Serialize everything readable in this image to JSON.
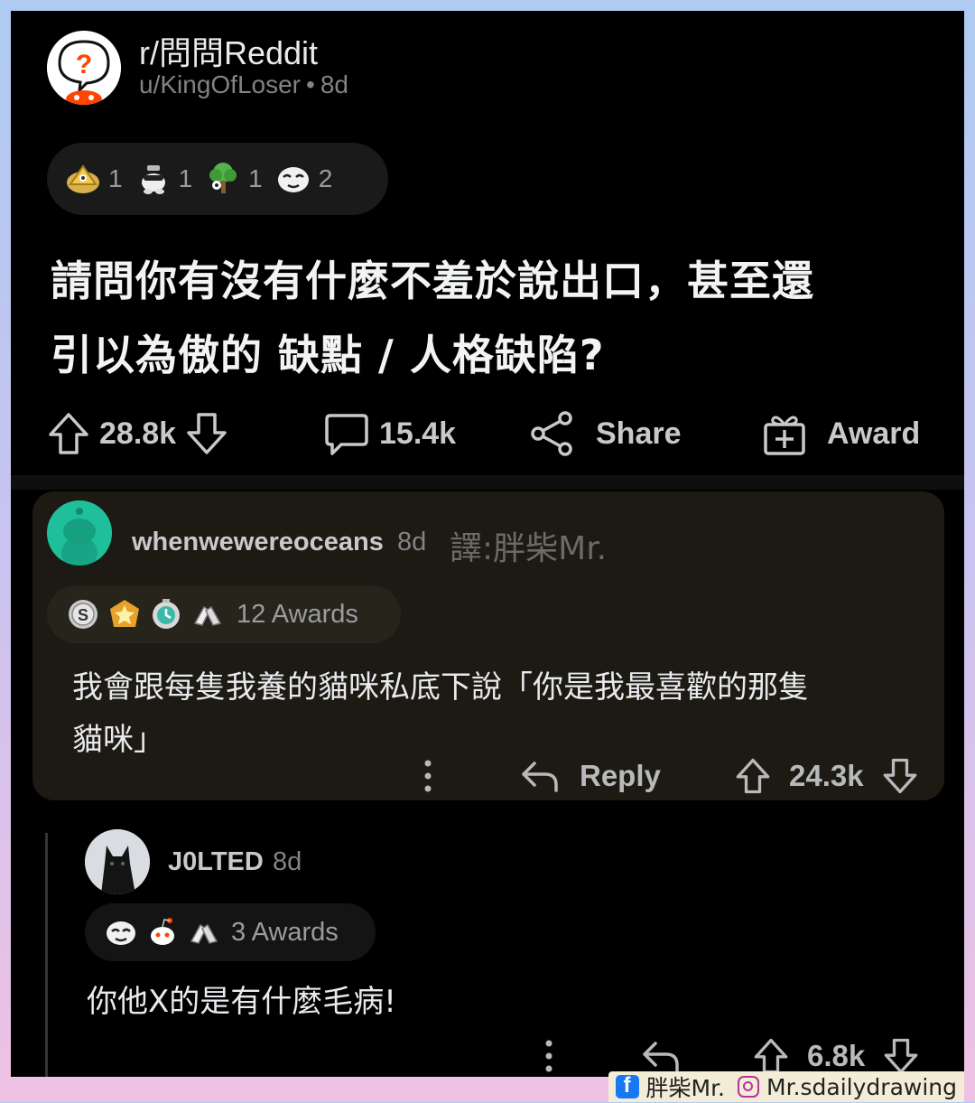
{
  "post": {
    "subreddit": "r/問問Reddit",
    "author": "u/KingOfLoser",
    "age": "8d",
    "awards": [
      {
        "icon": "pyramid-award-icon",
        "count": "1"
      },
      {
        "icon": "snoo-sunglasses-award-icon",
        "count": "1"
      },
      {
        "icon": "tree-award-icon",
        "count": "1"
      },
      {
        "icon": "face-award-icon",
        "count": "2"
      }
    ],
    "title_line1": "請問你有沒有什麼不羞於說出口，甚至還",
    "title_line2": "引以為傲的 缺點 / 人格缺陷?",
    "upvotes": "28.8k",
    "comments": "15.4k",
    "share_label": "Share",
    "award_label": "Award"
  },
  "comments": [
    {
      "user": "whenwewereoceans",
      "age": "8d",
      "translator_note": "譯:胖柴Mr.",
      "avatar_color": "#1fbf9b",
      "awards_label": "12 Awards",
      "award_icons": [
        "silver-coin-award-icon",
        "star-badge-award-icon",
        "timer-award-icon",
        "hands-award-icon"
      ],
      "text_line1": "我會跟每隻我養的貓咪私底下說「你是我最喜歡的那隻",
      "text_line2": "貓咪」",
      "reply_label": "Reply",
      "score": "24.3k"
    },
    {
      "user": "J0LTED",
      "age": "8d",
      "awards_label": "3 Awards",
      "award_icons": [
        "face-award-icon",
        "snoo-award-icon",
        "hands-award-icon"
      ],
      "text": "你他X的是有什麼毛病!",
      "score": "6.8k"
    }
  ],
  "credit": {
    "fb_name": "胖柴Mr.",
    "ig_name": "Mr.sdailydrawing"
  },
  "colors": {
    "background": "#000000",
    "highlight_comment": "#1c1a12",
    "frame_top": "#aecbf2",
    "frame_bottom": "#efc2e4"
  }
}
